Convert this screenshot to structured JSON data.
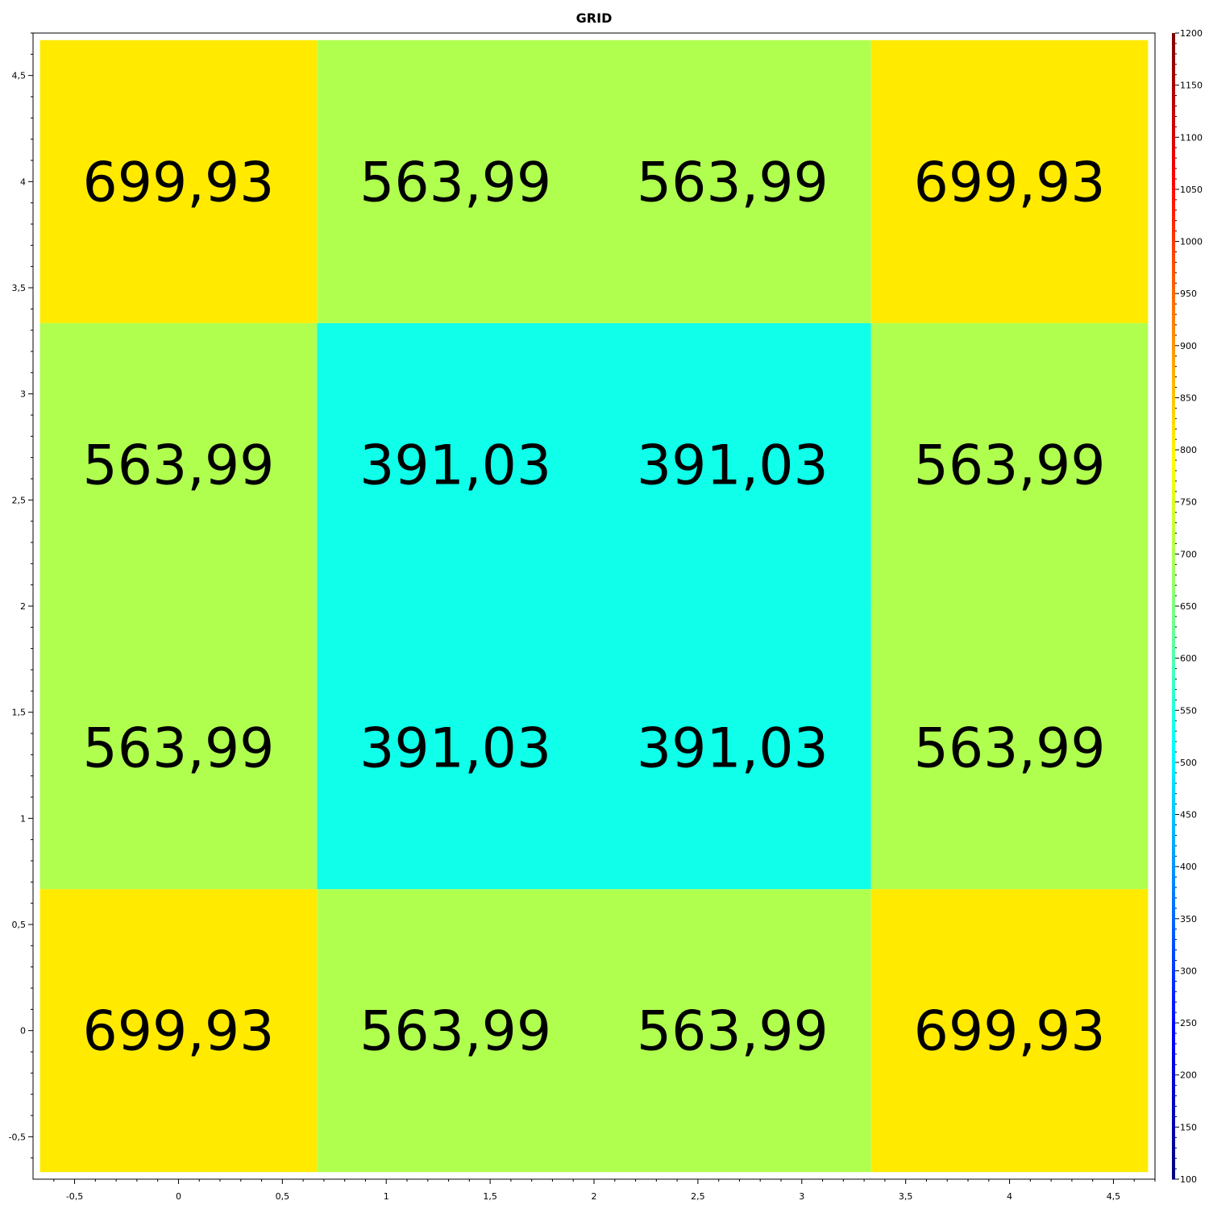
{
  "chart_data": {
    "type": "heatmap",
    "title": "GRID",
    "x_centers": [
      0,
      1.3333,
      2.6667,
      4
    ],
    "y_centers": [
      0,
      1.3333,
      2.6667,
      4
    ],
    "cell_size": 1.3333,
    "values": [
      [
        699.93,
        563.99,
        563.99,
        699.93
      ],
      [
        563.99,
        391.03,
        391.03,
        563.99
      ],
      [
        563.99,
        391.03,
        391.03,
        563.99
      ],
      [
        699.93,
        563.99,
        563.99,
        699.93
      ]
    ],
    "cell_labels": [
      [
        "699,93",
        "563,99",
        "563,99",
        "699,93"
      ],
      [
        "563,99",
        "391,03",
        "391,03",
        "563,99"
      ],
      [
        "563,99",
        "391,03",
        "391,03",
        "563,99"
      ],
      [
        "699,93",
        "563,99",
        "563,99",
        "699,93"
      ]
    ],
    "x_ticks": [
      -0.5,
      0,
      0.5,
      1,
      1.5,
      2,
      2.5,
      3,
      3.5,
      4,
      4.5
    ],
    "x_tick_labels": [
      "-0,5",
      "0",
      "0,5",
      "1",
      "1,5",
      "2",
      "2,5",
      "3",
      "3,5",
      "4",
      "4,5"
    ],
    "y_ticks": [
      -0.5,
      0,
      0.5,
      1,
      1.5,
      2,
      2.5,
      3,
      3.5,
      4,
      4.5
    ],
    "y_tick_labels": [
      "-0,5",
      "0",
      "0,5",
      "1",
      "1,5",
      "2",
      "2,5",
      "3",
      "3,5",
      "4",
      "4,5"
    ],
    "xlim": [
      -0.7,
      4.7
    ],
    "ylim": [
      -0.7,
      4.7
    ],
    "colorbar": {
      "min": 100,
      "max": 1200,
      "ticks": [
        100,
        150,
        200,
        250,
        300,
        350,
        400,
        450,
        500,
        550,
        600,
        650,
        700,
        750,
        800,
        850,
        900,
        950,
        1000,
        1050,
        1100,
        1150,
        1200
      ],
      "colormap": "jet"
    },
    "cell_colors": {
      "699.93": "#ffea00",
      "563.99": "#b0ff4f",
      "391.03": "#0fffea"
    },
    "grid": false,
    "legend": "colorbar-right"
  }
}
